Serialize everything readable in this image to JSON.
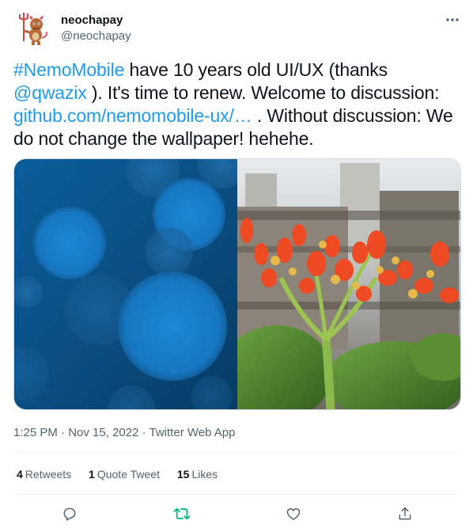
{
  "author": {
    "display_name": "neochapay",
    "handle": "@neochapay"
  },
  "tweet": {
    "hashtag": "#NemoMobile",
    "text_1": " have 10 years old UI/UX (thanks ",
    "mention": "@qwazix",
    "text_2": " ). It's time to renew. Welcome to discussion: ",
    "url": "github.com/nemomobile-ux/…",
    "text_3": " . Without discussion: We do not change the wallpaper! hehehe."
  },
  "meta": {
    "time": "1:25 PM",
    "separator": " · ",
    "date": "Nov 15, 2022",
    "source": "Twitter Web App"
  },
  "stats": {
    "retweets_count": "4",
    "retweets_label": "Retweets",
    "quote_count": "1",
    "quote_label": "Quote Tweet",
    "likes_count": "15",
    "likes_label": "Likes"
  },
  "icons": {
    "more": "more-horizontal-icon",
    "reply": "reply-icon",
    "retweet": "retweet-icon",
    "like": "heart-icon",
    "share": "share-icon"
  },
  "colors": {
    "link": "#1d9bf0",
    "retweet_active": "#00ba7c",
    "secondary_text": "#536471",
    "primary_text": "#0f1419"
  }
}
